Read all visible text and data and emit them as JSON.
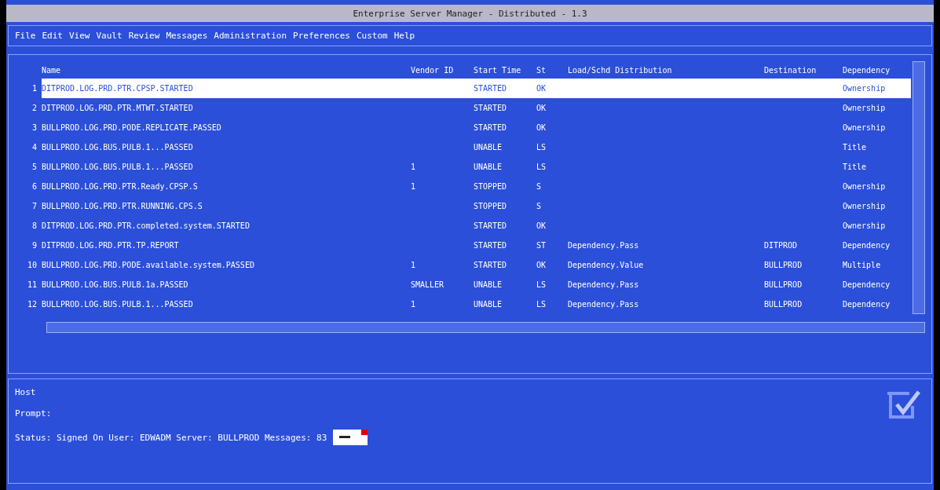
{
  "window": {
    "title": "Enterprise Server Manager - Distributed - 1.3"
  },
  "menu": [
    "File",
    "Edit",
    "View",
    "Vault",
    "Review",
    "Messages",
    "Administration",
    "Preferences",
    "Custom",
    "Help"
  ],
  "table": {
    "columns": [
      "",
      "Name",
      "Vendor ID",
      "Start Time",
      "St",
      "Load/Schd Distribution",
      "Destination",
      "Dependency"
    ],
    "rows": [
      {
        "selected": true,
        "cells": [
          "1",
          "DITPROD.LOG.PRD.PTR.CPSP.STARTED",
          "",
          "STARTED",
          "OK",
          "",
          "",
          "Ownership"
        ]
      },
      {
        "selected": false,
        "cells": [
          "2",
          "DITPROD.LOG.PRD.PTR.MTWT.STARTED",
          "",
          "STARTED",
          "OK",
          "",
          "",
          "Ownership"
        ]
      },
      {
        "selected": false,
        "cells": [
          "3",
          "BULLPROD.LOG.PRD.PODE.REPLICATE.PASSED",
          "",
          "STARTED",
          "OK",
          "",
          "",
          "Ownership"
        ]
      },
      {
        "selected": false,
        "cells": [
          "4",
          "BULLPROD.LOG.BUS.PULB.1...PASSED",
          "",
          "UNABLE",
          "LS",
          "",
          "",
          "Title"
        ]
      },
      {
        "selected": false,
        "cells": [
          "5",
          "BULLPROD.LOG.BUS.PULB.1...PASSED",
          "1",
          "UNABLE",
          "LS",
          "",
          "",
          "Title"
        ]
      },
      {
        "selected": false,
        "cells": [
          "6",
          "BULLPROD.LOG.PRD.PTR.Ready.CPSP.S",
          "1",
          "STOPPED",
          "S",
          "",
          "",
          "Ownership"
        ]
      },
      {
        "selected": false,
        "cells": [
          "7",
          "BULLPROD.LOG.PRD.PTR.RUNNING.CPS.S",
          "",
          "STOPPED",
          "S",
          "",
          "",
          "Ownership"
        ]
      },
      {
        "selected": false,
        "cells": [
          "8",
          "DITPROD.LOG.PRD.PTR.completed.system.STARTED",
          "",
          "STARTED",
          "OK",
          "",
          "",
          "Ownership"
        ]
      },
      {
        "selected": false,
        "cells": [
          "9",
          "DITPROD.LOG.PRD.PTR.TP.REPORT",
          "",
          "STARTED",
          "ST",
          "Dependency.Pass",
          "DITPROD",
          "Dependency"
        ]
      },
      {
        "selected": false,
        "cells": [
          "10",
          "BULLPROD.LOG.PRD.PODE.available.system.PASSED",
          "1",
          "STARTED",
          "OK",
          "Dependency.Value",
          "BULLPROD",
          "Multiple"
        ]
      },
      {
        "selected": false,
        "cells": [
          "11",
          "BULLPROD.LOG.BUS.PULB.1a.PASSED",
          "SMALLER",
          "UNABLE",
          "LS",
          "Dependency.Pass",
          "BULLPROD",
          "Dependency"
        ]
      },
      {
        "selected": false,
        "cells": [
          "12",
          "BULLPROD.LOG.BUS.PULB.1...PASSED",
          "1",
          "UNABLE",
          "LS",
          "Dependency.Pass",
          "BULLPROD",
          "Dependency"
        ]
      }
    ]
  },
  "bottom": {
    "host_label": "Host",
    "prompt_label": "Prompt:",
    "status": "Status: Signed On  User: EDWADM  Server: BULLPROD  Messages: 83"
  }
}
